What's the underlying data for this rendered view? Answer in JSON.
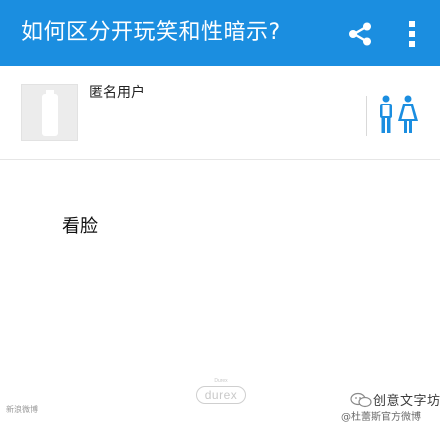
{
  "appbar": {
    "title": "如何区分开玩笑和性暗示?",
    "background": "#1b8ee0",
    "share_icon": "share-icon",
    "more_icon": "more-vertical-icon"
  },
  "user": {
    "name": "匿名用户",
    "avatar_icon": "avatar-placeholder-icon",
    "gender_icon": "male-female-icon"
  },
  "answer": {
    "text": "看脸"
  },
  "watermarks": {
    "left_text": "新浪微博",
    "center_brand_top": "Durex",
    "center_brand": "durex",
    "brand_name": "创意文字坊",
    "brand_sub": "@杜蕾斯官方微博"
  }
}
